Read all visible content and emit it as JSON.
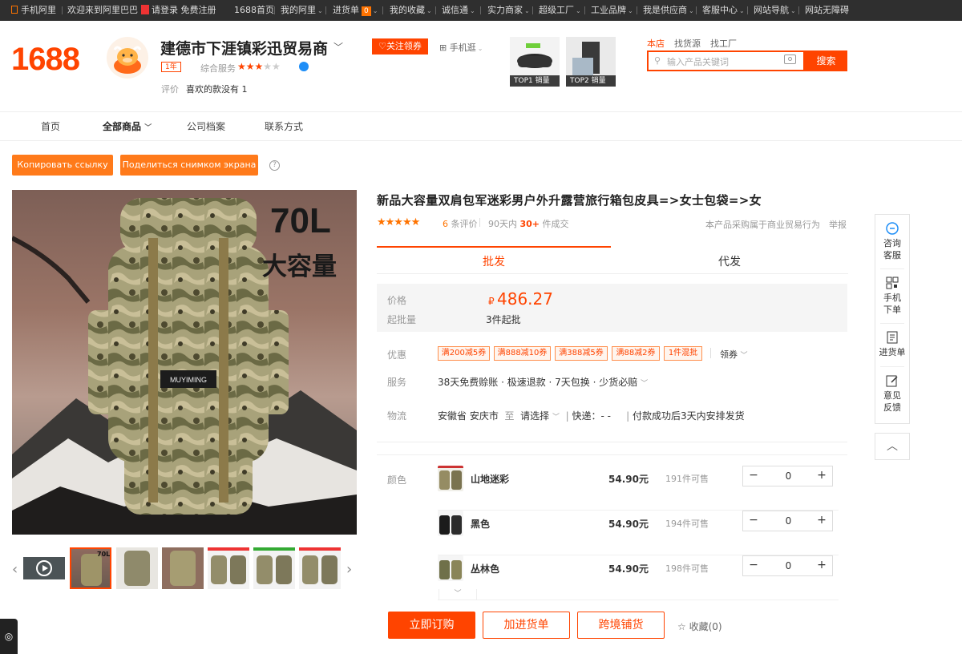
{
  "topbar": {
    "mobile_ali": "手机阿里",
    "welcome": "欢迎来到阿里巴巴",
    "login": "请登录",
    "register": "免费注册",
    "home": "1688首页",
    "my_ali": "我的阿里",
    "cart": "进货单",
    "cart_count": "0",
    "favorites": "我的收藏",
    "trust": "诚信通",
    "merchant": "实力商家",
    "super_factory": "超级工厂",
    "industrial": "工业品牌",
    "supplier": "我是供应商",
    "service": "客服中心",
    "site_nav": "网站导航",
    "accessible": "网站无障碍"
  },
  "header": {
    "logo": "1688",
    "shop_name": "建德市下涯镇彩迅贸易商",
    "year_badge": "1年",
    "service_label": "综合服务",
    "rating_stars": 3,
    "eval_label": "评价",
    "eval_value": "喜欢的款没有 1",
    "follow_button": "关注领券",
    "mobile_shop": "手机逛",
    "top1_tag": "TOP1 销量",
    "top2_tag": "TOP2 销量",
    "search_scopes": [
      "本店",
      "找货源",
      "找工厂"
    ],
    "search_placeholder": "输入产品关键词",
    "search_button": "搜索"
  },
  "nav": {
    "items": [
      "首页",
      "全部商品",
      "公司档案",
      "联系方式"
    ]
  },
  "actions": {
    "copy_link": "Копировать ссылку",
    "share_screenshot": "Поделиться снимком экрана",
    "help": "?"
  },
  "product": {
    "title": "新品大容量双肩包军迷彩男户外升露营旅行箱包皮具=>女士包袋=>女",
    "image_text_big": "70L",
    "image_text_sub": "大容量",
    "review_count": "6",
    "review_label": "条评价",
    "sold_prefix": "90天内",
    "sold_count": "30+",
    "sold_suffix": "件成交",
    "purchase_note": "本产品采购属于商业贸易行为",
    "report": "举报",
    "tabs": [
      "批发",
      "代发"
    ],
    "price_label": "价格",
    "currency": "₽",
    "price": "486.27",
    "moq_label": "起批量",
    "moq_value": "3件起批",
    "promo_label": "优惠",
    "promos": [
      "满200减5券",
      "满888减10券",
      "满388减5券",
      "满88减2券",
      "1件混批"
    ],
    "coupons": "领券",
    "service_label": "服务",
    "service_value": "38天免费赊账 · 极速退款 · 7天包换 · 少货必赔",
    "logistics_label": "物流",
    "origin": "安徽省 安庆市",
    "to": "至",
    "dest": "请选择",
    "express": "快递：- -",
    "ship_note": "付款成功后3天内安排发货",
    "color_label": "颜色",
    "skus": [
      {
        "name": "山地迷彩",
        "price": "54.90元",
        "stock": "191件可售",
        "qty": "0"
      },
      {
        "name": "黑色",
        "price": "54.90元",
        "stock": "194件可售",
        "qty": "0"
      },
      {
        "name": "丛林色",
        "price": "54.90元",
        "stock": "198件可售",
        "qty": "0"
      }
    ],
    "buy_now": "立即订购",
    "add_cart": "加进货单",
    "cross_border": "跨境铺货",
    "favorite": "收藏(0)"
  },
  "sidebar": {
    "consult": "咨询客服",
    "mobile_order": "手机下单",
    "cart": "进货单",
    "feedback": "意见反馈"
  },
  "colors": {
    "accent": "#ff4400",
    "orange_btn": "#ff7a1a",
    "topbar_bg": "#2f2f2f"
  }
}
